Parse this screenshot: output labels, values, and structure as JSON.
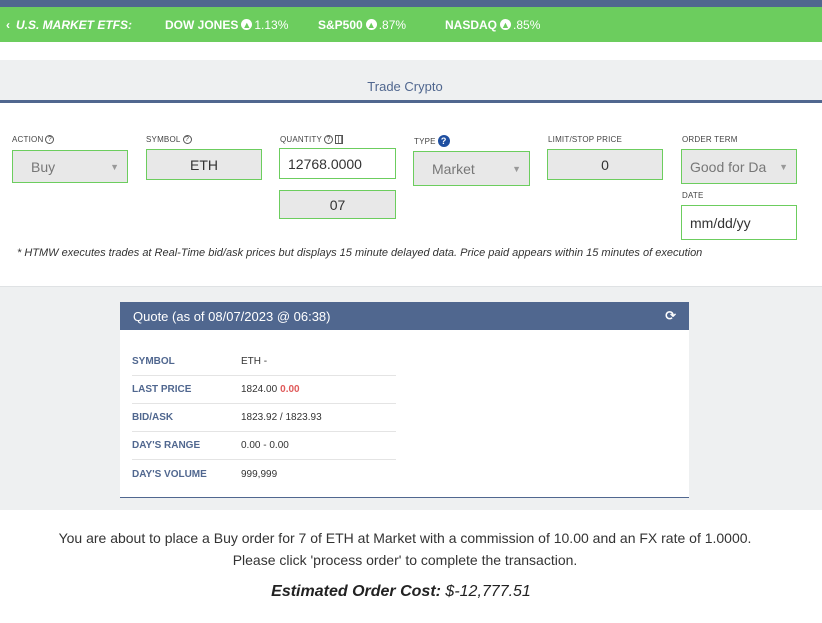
{
  "ticker": {
    "label": "U.S. MARKET ETFS:",
    "items": [
      {
        "name": "DOW JONES",
        "change": "1.13%"
      },
      {
        "name": "S&P500",
        "change": ".87%"
      },
      {
        "name": "NASDAQ",
        "change": ".85%"
      }
    ]
  },
  "trade": {
    "title": "Trade Crypto",
    "action": {
      "label": "ACTION",
      "value": "Buy"
    },
    "symbol": {
      "label": "SYMBOL",
      "value": "ETH"
    },
    "quantity": {
      "label": "QUANTITY",
      "value": "12768.0000",
      "secondary": "07"
    },
    "type": {
      "label": "TYPE",
      "value": "Market"
    },
    "limit": {
      "label": "LIMIT/STOP PRICE",
      "value": "0"
    },
    "term": {
      "label": "ORDER TERM",
      "value": "Good for Da"
    },
    "date": {
      "label": "DATE",
      "placeholder": "mm/dd/yy"
    },
    "note": "* HTMW executes trades at Real-Time bid/ask prices but displays 15 minute delayed data. Price paid appears within 15 minutes of execution"
  },
  "quote": {
    "title": "Quote (as of 08/07/2023 @ 06:38)",
    "symbol_label": "SYMBOL",
    "symbol": "ETH -",
    "last_label": "LAST PRICE",
    "last": "1824.00",
    "change": "0.00",
    "bidask_label": "BID/ASK",
    "bidask": "1823.92 / 1823.93",
    "range_label": "DAY'S RANGE",
    "range": "0.00 - 0.00",
    "volume_label": "DAY'S VOLUME",
    "volume": "999,999"
  },
  "summary": {
    "line1": "You are about to place a Buy order for 7 of ETH at Market with a commission of 10.00 and an FX rate of 1.0000.",
    "line2": "Please click 'process order' to complete the transaction.",
    "estimate_label": "Estimated Order Cost:",
    "estimate_value": "$-12,777.51"
  }
}
